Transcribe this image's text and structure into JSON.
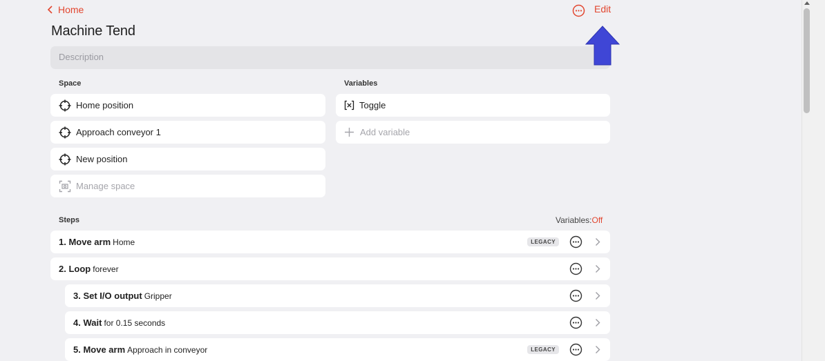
{
  "header": {
    "back_label": "Home",
    "edit_label": "Edit",
    "title": "Machine Tend"
  },
  "description": {
    "placeholder": "Description"
  },
  "space": {
    "label": "Space",
    "items": [
      {
        "label": "Home position",
        "icon": "crosshair-icon"
      },
      {
        "label": "Approach conveyor 1",
        "icon": "crosshair-icon"
      },
      {
        "label": "New position",
        "icon": "crosshair-icon"
      }
    ],
    "manage_label": "Manage space",
    "manage_icon": "scan-icon"
  },
  "variables": {
    "label": "Variables",
    "items": [
      {
        "label": "Toggle",
        "icon": "variable-x-icon"
      }
    ],
    "add_label": "Add variable",
    "add_icon": "plus-icon"
  },
  "steps": {
    "label": "Steps",
    "variables_toggle_label": "Variables:",
    "variables_toggle_value": "Off",
    "legacy_badge": "LEGACY",
    "items": [
      {
        "number": "1.",
        "name": "Move arm",
        "detail": "Home",
        "legacy": true,
        "indent": false
      },
      {
        "number": "2.",
        "name": "Loop",
        "detail": "forever",
        "legacy": false,
        "indent": false
      },
      {
        "number": "3.",
        "name": "Set I/O output",
        "detail": "Gripper",
        "legacy": false,
        "indent": true
      },
      {
        "number": "4.",
        "name": "Wait",
        "detail": "for 0.15 seconds",
        "legacy": false,
        "indent": true
      },
      {
        "number": "5.",
        "name": "Move arm",
        "detail": "Approach in conveyor",
        "legacy": true,
        "indent": true
      }
    ]
  },
  "colors": {
    "accent": "#e2462f",
    "arrow": "#3f46d6",
    "background": "#f0f0f3",
    "card": "#ffffff"
  }
}
